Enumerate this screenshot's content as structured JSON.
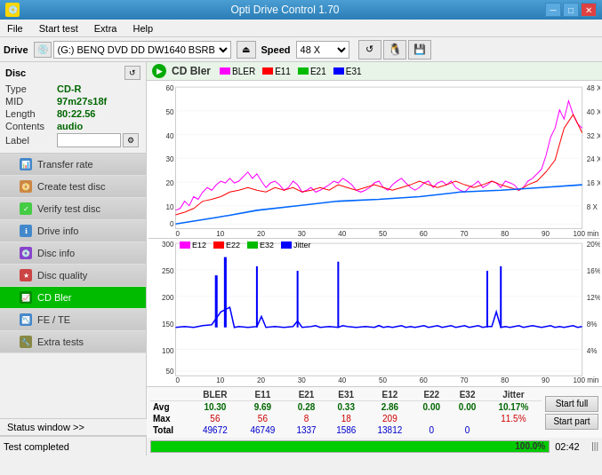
{
  "titlebar": {
    "icon": "💿",
    "title": "Opti Drive Control 1.70",
    "minimize": "─",
    "maximize": "□",
    "close": "✕"
  },
  "menubar": {
    "items": [
      "File",
      "Start test",
      "Extra",
      "Help"
    ]
  },
  "drive": {
    "label": "Drive",
    "icon": "💿",
    "value": "(G:)  BENQ DVD DD DW1640 BSRB",
    "speed_label": "Speed",
    "speed_value": "48 X"
  },
  "toolbar": {
    "reset": "↺",
    "floppy": "💾",
    "save": "💾"
  },
  "disc": {
    "title": "Disc",
    "type_label": "Type",
    "type_value": "CD-R",
    "mid_label": "MID",
    "mid_value": "97m27s18f",
    "length_label": "Length",
    "length_value": "80:22.56",
    "contents_label": "Contents",
    "contents_value": "audio",
    "label_label": "Label"
  },
  "nav": {
    "items": [
      {
        "id": "transfer-rate",
        "label": "Transfer rate",
        "icon": "📊"
      },
      {
        "id": "create-test-disc",
        "label": "Create test disc",
        "icon": "📀"
      },
      {
        "id": "verify-test-disc",
        "label": "Verify test disc",
        "icon": "✓"
      },
      {
        "id": "drive-info",
        "label": "Drive info",
        "icon": "ℹ"
      },
      {
        "id": "disc-info",
        "label": "Disc info",
        "icon": "💿"
      },
      {
        "id": "disc-quality",
        "label": "Disc quality",
        "icon": "★"
      },
      {
        "id": "cd-bler",
        "label": "CD Bler",
        "icon": "📈",
        "active": true
      },
      {
        "id": "fe-te",
        "label": "FE / TE",
        "icon": "📉"
      },
      {
        "id": "extra-tests",
        "label": "Extra tests",
        "icon": "🔧"
      }
    ]
  },
  "chart": {
    "title": "CD Bler",
    "legend1": [
      {
        "label": "BLER",
        "color": "#ff00ff"
      },
      {
        "label": "E11",
        "color": "#ff0000"
      },
      {
        "label": "E21",
        "color": "#00ff00"
      },
      {
        "label": "E31",
        "color": "#0000ff"
      }
    ],
    "legend2": [
      {
        "label": "E12",
        "color": "#ff00ff"
      },
      {
        "label": "E22",
        "color": "#ff0000"
      },
      {
        "label": "E32",
        "color": "#00ff00"
      },
      {
        "label": "Jitter",
        "color": "#0000ff"
      }
    ]
  },
  "stats": {
    "headers": [
      "",
      "BLER",
      "E11",
      "E21",
      "E31",
      "E12",
      "E22",
      "E32",
      "Jitter"
    ],
    "avg": {
      "label": "Avg",
      "values": [
        "10.30",
        "9.69",
        "0.28",
        "0.33",
        "2.86",
        "0.00",
        "0.00",
        "10.17%"
      ]
    },
    "max": {
      "label": "Max",
      "values": [
        "56",
        "56",
        "8",
        "18",
        "209",
        "",
        "",
        "11.5%"
      ]
    },
    "total": {
      "label": "Total",
      "values": [
        "49672",
        "46749",
        "1337",
        "1586",
        "13812",
        "0",
        "0",
        ""
      ]
    }
  },
  "buttons": {
    "start_full": "Start full",
    "start_part": "Start part"
  },
  "statusbar": {
    "status_window": "Status window >>",
    "status_text": "Test completed",
    "progress": "100.0%",
    "time": "02:42",
    "signal_icon": "|||"
  }
}
